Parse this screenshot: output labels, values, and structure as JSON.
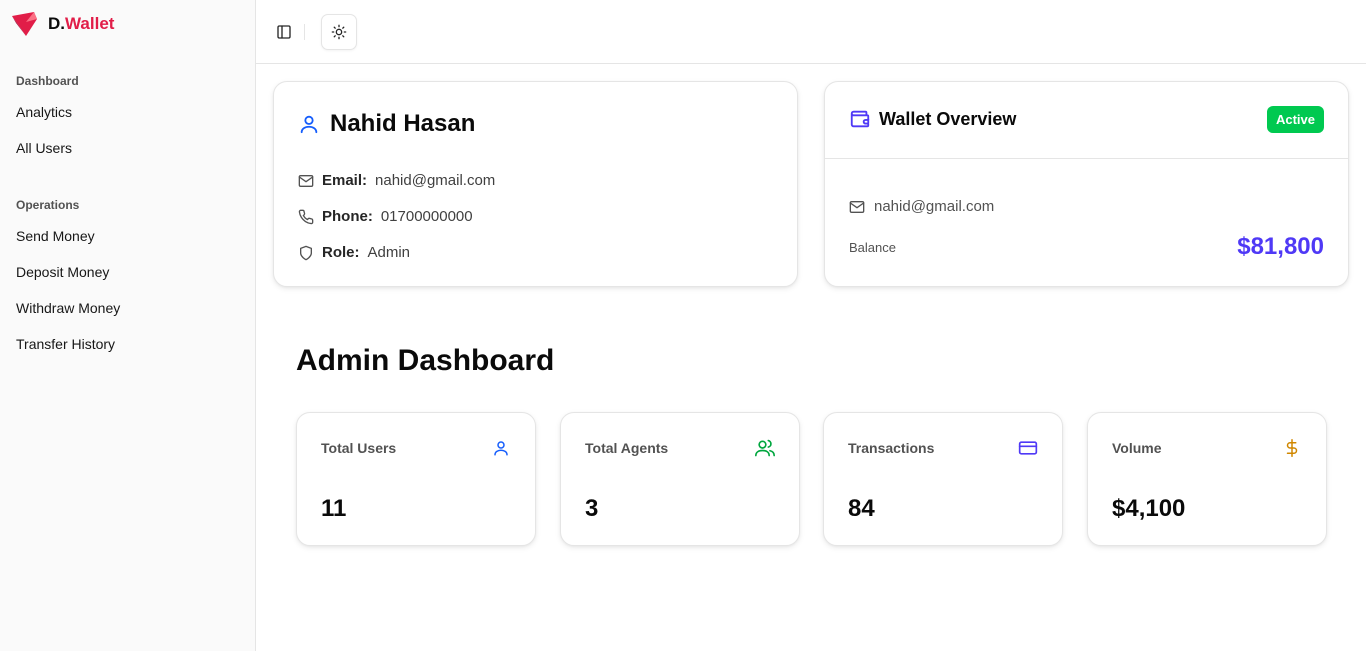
{
  "brand": {
    "prefix": "D.",
    "name": "Wallet",
    "accent": "#e11d48"
  },
  "sidebar": {
    "groups": [
      {
        "label": "Dashboard",
        "items": [
          {
            "label": "Analytics"
          },
          {
            "label": "All Users"
          }
        ]
      },
      {
        "label": "Operations",
        "items": [
          {
            "label": "Send Money"
          },
          {
            "label": "Deposit Money"
          },
          {
            "label": "Withdraw Money"
          },
          {
            "label": "Transfer History"
          }
        ]
      }
    ]
  },
  "header": {
    "sidebar_toggle_icon": "panel-left-icon",
    "theme_toggle_icon": "sun-icon"
  },
  "profile": {
    "name": "Nahid Hasan",
    "email_label": "Email:",
    "email": "nahid@gmail.com",
    "phone_label": "Phone:",
    "phone": "01700000000",
    "role_label": "Role:",
    "role": "Admin"
  },
  "wallet": {
    "title": "Wallet Overview",
    "status": "Active",
    "email": "nahid@gmail.com",
    "balance_label": "Balance",
    "balance": "$81,800",
    "balance_color": "#4f39f6",
    "status_color": "#00c950"
  },
  "dashboard": {
    "title": "Admin Dashboard",
    "stats": [
      {
        "label": "Total Users",
        "value": "11",
        "icon": "user-icon",
        "color": "#155dfc"
      },
      {
        "label": "Total Agents",
        "value": "3",
        "icon": "users-icon",
        "color": "#00a63e"
      },
      {
        "label": "Transactions",
        "value": "84",
        "icon": "credit-card-icon",
        "color": "#4f39f6"
      },
      {
        "label": "Volume",
        "value": "$4,100",
        "icon": "dollar-sign-icon",
        "color": "#d08700"
      }
    ]
  }
}
